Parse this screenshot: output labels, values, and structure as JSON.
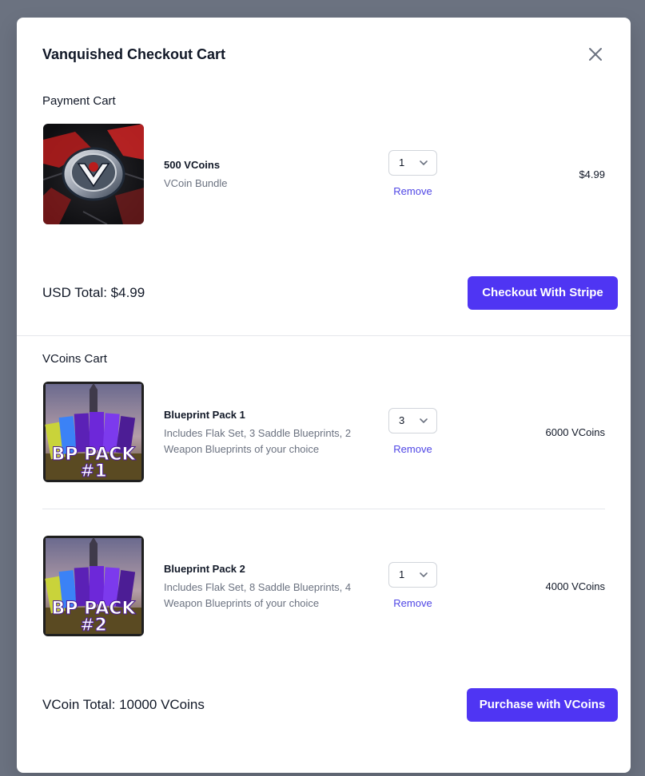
{
  "modal": {
    "title": "Vanquished Checkout Cart"
  },
  "payment_cart": {
    "section_title": "Payment Cart",
    "items": [
      {
        "name": "500 VCoins",
        "description": "VCoin Bundle",
        "quantity": "1",
        "remove_label": "Remove",
        "price": "$4.99"
      }
    ],
    "total_label": "USD Total: $4.99",
    "checkout_button": "Checkout With Stripe"
  },
  "vcoins_cart": {
    "section_title": "VCoins Cart",
    "items": [
      {
        "name": "Blueprint Pack 1",
        "description": "Includes Flak Set, 3 Saddle Blueprints, 2 Weapon Blueprints of your choice",
        "quantity": "3",
        "remove_label": "Remove",
        "price": "6000 VCoins",
        "image_text_line1": "BP PACK",
        "image_text_line2": "#1"
      },
      {
        "name": "Blueprint Pack 2",
        "description": "Includes Flak Set, 8 Saddle Blueprints, 4 Weapon Blueprints of your choice",
        "quantity": "1",
        "remove_label": "Remove",
        "price": "4000 VCoins",
        "image_text_line1": "BP PACK",
        "image_text_line2": "#2"
      }
    ],
    "total_label": "VCoin Total: 10000 VCoins",
    "purchase_button": "Purchase with VCoins"
  },
  "colors": {
    "accent": "#4f35f3",
    "link": "#4f46e5",
    "overlay": "#6b7280"
  },
  "icons": {
    "close": "close-icon",
    "chevron": "chevron-down-icon"
  }
}
